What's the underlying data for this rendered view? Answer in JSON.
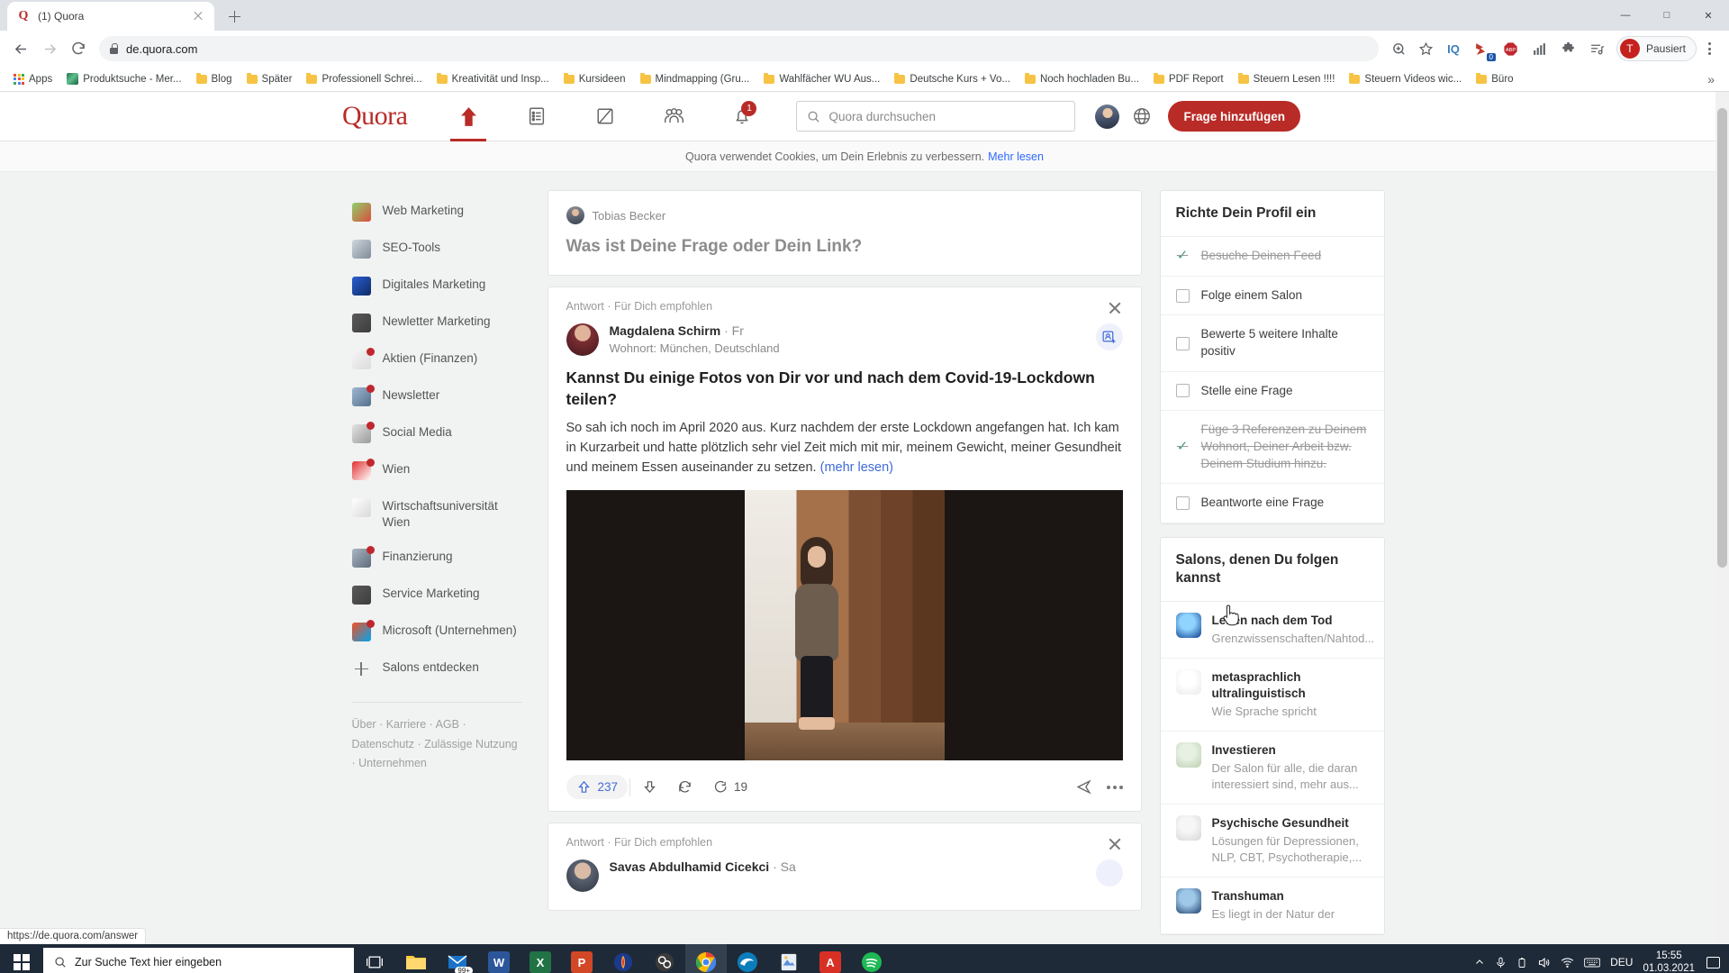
{
  "browser": {
    "tab": {
      "title": "(1) Quora",
      "favicon": "Q"
    },
    "url": "de.quora.com",
    "profile_label": "Pausiert",
    "profile_initial": "T",
    "extensions": [
      "zoom-icon",
      "bookmark-star-icon",
      "iq-icon",
      "pocket-icon",
      "adblock-plus-icon",
      "stats-icon",
      "puzzle-extensions-icon",
      "playlist-icon"
    ],
    "bookmarks": [
      {
        "label": "Apps",
        "icon": "apps-grid-icon"
      },
      {
        "label": "Produktsuche - Mer...",
        "icon": "site-icon"
      },
      {
        "label": "Blog",
        "icon": "folder-icon"
      },
      {
        "label": "Später",
        "icon": "folder-icon"
      },
      {
        "label": "Professionell Schrei...",
        "icon": "folder-icon"
      },
      {
        "label": "Kreativität und Insp...",
        "icon": "folder-icon"
      },
      {
        "label": "Kursideen",
        "icon": "folder-icon"
      },
      {
        "label": "Mindmapping  (Gru...",
        "icon": "folder-icon"
      },
      {
        "label": "Wahlfächer WU Aus...",
        "icon": "folder-icon"
      },
      {
        "label": "Deutsche Kurs + Vo...",
        "icon": "folder-icon"
      },
      {
        "label": "Noch hochladen Bu...",
        "icon": "folder-icon"
      },
      {
        "label": "PDF Report",
        "icon": "folder-icon"
      },
      {
        "label": "Steuern Lesen !!!!",
        "icon": "folder-icon"
      },
      {
        "label": "Steuern Videos wic...",
        "icon": "folder-icon"
      },
      {
        "label": "Büro",
        "icon": "folder-icon"
      }
    ],
    "bookmarks_overflow": "»",
    "status_url": "https://de.quora.com/answer"
  },
  "quora": {
    "logo": "Quora",
    "nav": [
      {
        "name": "home",
        "active": true
      },
      {
        "name": "answer",
        "active": false
      },
      {
        "name": "write",
        "active": false
      },
      {
        "name": "spaces",
        "active": false
      },
      {
        "name": "notifications",
        "active": false,
        "badge": "1"
      }
    ],
    "search_placeholder": "Quora durchsuchen",
    "add_question_label": "Frage hinzufügen",
    "cookie_text": "Quora verwendet Cookies, um Dein Erlebnis zu verbessern.",
    "cookie_link": "Mehr lesen",
    "accent_color": "#b92b27"
  },
  "sidebar": {
    "items": [
      {
        "label": "Web Marketing",
        "dot": false,
        "color1": "#8fd06a",
        "color2": "#d94f3d"
      },
      {
        "label": "SEO-Tools",
        "dot": false,
        "color1": "#cfd6dd",
        "color2": "#7f8b99"
      },
      {
        "label": "Digitales Marketing",
        "dot": false,
        "color1": "#2a5fd0",
        "color2": "#0e2a66"
      },
      {
        "label": "Newletter Marketing",
        "dot": false,
        "color1": "#5a5a5a",
        "color2": "#3d3d3d"
      },
      {
        "label": "Aktien (Finanzen)",
        "dot": true,
        "color1": "#f4f4f4",
        "color2": "#dcdcdc"
      },
      {
        "label": "Newsletter",
        "dot": true,
        "color1": "#9fb6d0",
        "color2": "#55708c"
      },
      {
        "label": "Social Media",
        "dot": true,
        "color1": "#e3e3e3",
        "color2": "#9a9a9a"
      },
      {
        "label": "Wien",
        "dot": true,
        "color1": "#e03030",
        "color2": "#ffffff"
      },
      {
        "label": "Wirtschaftsuniversität Wien",
        "dot": false,
        "color1": "#ffffff",
        "color2": "#d8d8d8"
      },
      {
        "label": "Finanzierung",
        "dot": true,
        "color1": "#aab6c4",
        "color2": "#5e6b7a"
      },
      {
        "label": "Service Marketing",
        "dot": false,
        "color1": "#5a5a5a",
        "color2": "#3d3d3d"
      },
      {
        "label": "Microsoft (Unternehmen)",
        "dot": true,
        "color1": "#f25022",
        "color2": "#00a4ef"
      }
    ],
    "discover_label": "Salons entdecken",
    "footer": "Über · Karriere · AGB · Datenschutz · Zulässige Nutzung · Unternehmen"
  },
  "ask_box": {
    "user": "Tobias Becker",
    "prompt": "Was ist Deine Frage oder Dein Link?"
  },
  "posts": [
    {
      "meta": "Antwort · Für Dich empfohlen",
      "author": "Magdalena Schirm",
      "time": "· Fr",
      "subtitle": "Wohnort: München, Deutschland",
      "title": "Kannst Du einige Fotos von Dir vor und nach dem Covid-19-Lockdown teilen?",
      "body": "So sah ich noch im April 2020 aus. Kurz nachdem der erste Lockdown angefangen hat. Ich kam in Kurzarbeit und hatte plötzlich sehr viel Zeit mich mit mir, meinem Gewicht, meiner Gesundheit und meinem Essen auseinander zu setzen.",
      "more_link": "(mehr lesen)",
      "upvotes": "237",
      "comments": "19"
    },
    {
      "meta": "Antwort · Für Dich empfohlen",
      "author": "Savas Abdulhamid Cicekci",
      "time": "· Sa"
    }
  ],
  "profile_panel": {
    "title": "Richte Dein Profil ein",
    "tasks": [
      {
        "label": "Besuche Deinen Feed",
        "done": true
      },
      {
        "label": "Folge einem Salon",
        "done": false
      },
      {
        "label": "Bewerte 5 weitere Inhalte positiv",
        "done": false
      },
      {
        "label": "Stelle eine Frage",
        "done": false
      },
      {
        "label": "Füge 3 Referenzen zu Deinem Wohnort, Deiner Arbeit bzw. Deinem Studium hinzu.",
        "done": true
      },
      {
        "label": "Beantworte eine Frage",
        "done": false
      }
    ]
  },
  "salons_panel": {
    "title": "Salons, denen Du folgen kannst",
    "items": [
      {
        "name": "Leben nach dem Tod",
        "desc": "Grenzwissenschaften/Nahtod...",
        "c1": "#8fd4ff",
        "c2": "#0a3a8f"
      },
      {
        "name": "metasprachlich ultralinguistisch",
        "desc": "Wie Sprache spricht",
        "c1": "#ffffff",
        "c2": "#e9e9e9"
      },
      {
        "name": "Investieren",
        "desc": "Der Salon für alle, die daran interessiert sind, mehr aus...",
        "c1": "#e8f0e4",
        "c2": "#b9cfae"
      },
      {
        "name": "Psychische Gesundheit",
        "desc": "Lösungen für Depressionen, NLP, CBT, Psychotherapie,...",
        "c1": "#f6f6f6",
        "c2": "#d6d6d6"
      },
      {
        "name": "Transhuman",
        "desc": "Es liegt in der Natur der",
        "c1": "#9fc8e8",
        "c2": "#1d3f6b"
      }
    ]
  },
  "taskbar": {
    "search_placeholder": "Zur Suche Text hier eingeben",
    "apps": [
      {
        "name": "task-view-icon",
        "label": "",
        "color": "transparent",
        "active": false
      },
      {
        "name": "file-explorer-icon",
        "label": "",
        "color": "#ffc83d",
        "active": false
      },
      {
        "name": "mail-icon",
        "label": "99+",
        "color": "#1a73c8",
        "active": false
      },
      {
        "name": "word-icon",
        "label": "W",
        "color": "#2b579a",
        "active": false
      },
      {
        "name": "excel-icon",
        "label": "X",
        "color": "#217346",
        "active": false
      },
      {
        "name": "powerpoint-icon",
        "label": "P",
        "color": "#d24726",
        "active": false
      },
      {
        "name": "audacity-icon",
        "label": "",
        "color": "#1b3a8c",
        "active": false
      },
      {
        "name": "obs-icon",
        "label": "",
        "color": "#3b3b3b",
        "active": false
      },
      {
        "name": "chrome-icon",
        "label": "",
        "color": "#4285f4",
        "active": true
      },
      {
        "name": "edge-icon",
        "label": "",
        "color": "#0c7dbb",
        "active": false
      },
      {
        "name": "snipping-tool-icon",
        "label": "",
        "color": "#5a8fd6",
        "active": false
      },
      {
        "name": "pdf-icon",
        "label": "A",
        "color": "#d93025",
        "active": false
      },
      {
        "name": "spotify-icon",
        "label": "",
        "color": "#1db954",
        "active": false
      }
    ],
    "tray": [
      "chevron-up-icon",
      "microphone-icon",
      "battery-icon",
      "volume-icon",
      "wifi-icon",
      "keyboard-icon"
    ],
    "language": "DEU",
    "time": "15:55",
    "date": "01.03.2021"
  }
}
